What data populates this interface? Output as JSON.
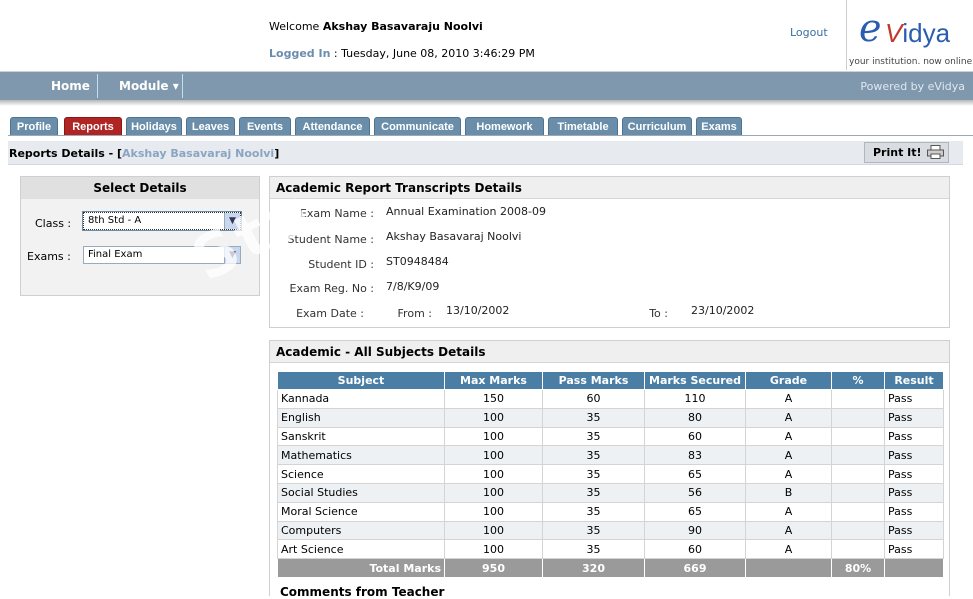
{
  "header": {
    "welcome_prefix": "Welcome",
    "user_name": "Akshay Basavaraju Noolvi",
    "logged_in_label": "Logged In",
    "logged_in_value": ": Tuesday, June 08, 2010 3:46:29 PM",
    "logout": "Logout",
    "logo_e": "e",
    "logo_v": "V",
    "logo_rest": "idya",
    "logo_tagline": "your institution. now online!"
  },
  "nav": {
    "home": "Home",
    "module": "Module ▾",
    "powered": "Powered by eVidya"
  },
  "tabs": [
    "Profile",
    "Reports",
    "Holidays",
    "Leaves",
    "Events",
    "Attendance",
    "Communicate",
    "Homework",
    "Timetable",
    "Curriculum",
    "Exams"
  ],
  "active_tab": "Reports",
  "breadcrumb": {
    "prefix": "Reports Details - [",
    "name": "Akshay Basavaraj Noolvi",
    "suffix": "]"
  },
  "print_label": "Print It!",
  "select_details": {
    "title": "Select Details",
    "class_label": "Class :",
    "class_value": "8th Std - A",
    "exams_label": "Exams :",
    "exams_value": "Final Exam"
  },
  "transcript": {
    "title": "Academic Report Transcripts Details",
    "exam_name_label": "Exam Name :",
    "exam_name": "Annual Examination 2008-09",
    "student_name_label": "Student Name :",
    "student_name": "Akshay Basavaraj  Noolvi",
    "student_id_label": "Student ID :",
    "student_id": "ST0948484",
    "reg_no_label": "Exam Reg. No :",
    "reg_no": "7/8/K9/09",
    "date_label": "Exam Date :",
    "from_label": "From :",
    "from_value": "13/10/2002",
    "to_label": "To :",
    "to_value": "23/10/2002"
  },
  "subjects": {
    "title": "Academic - All Subjects Details",
    "columns": [
      "Subject",
      "Max Marks",
      "Pass Marks",
      "Marks Secured",
      "Grade",
      "%",
      "Result"
    ],
    "rows": [
      [
        "Kannada",
        "150",
        "60",
        "110",
        "A",
        "",
        "Pass"
      ],
      [
        "English",
        "100",
        "35",
        "80",
        "A",
        "",
        "Pass"
      ],
      [
        "Sanskrit",
        "100",
        "35",
        "60",
        "A",
        "",
        "Pass"
      ],
      [
        "Mathematics",
        "100",
        "35",
        "83",
        "A",
        "",
        "Pass"
      ],
      [
        "Science",
        "100",
        "35",
        "65",
        "A",
        "",
        "Pass"
      ],
      [
        "Social Studies",
        "100",
        "35",
        "56",
        "B",
        "",
        "Pass"
      ],
      [
        "Moral Science",
        "100",
        "35",
        "65",
        "A",
        "",
        "Pass"
      ],
      [
        "Computers",
        "100",
        "35",
        "90",
        "A",
        "",
        "Pass"
      ],
      [
        "Art Science",
        "100",
        "35",
        "60",
        "A",
        "",
        "Pass"
      ]
    ],
    "total": [
      "Total Marks",
      "950",
      "320",
      "669",
      "",
      "80%",
      ""
    ],
    "comments_title": "Comments from Teacher"
  },
  "colors": {
    "nav": "#7f98ad",
    "active_tab": "#b02424",
    "tab": "#6a8ea9",
    "table_head": "#4b7ea5",
    "total_row": "#9a9a9a"
  }
}
